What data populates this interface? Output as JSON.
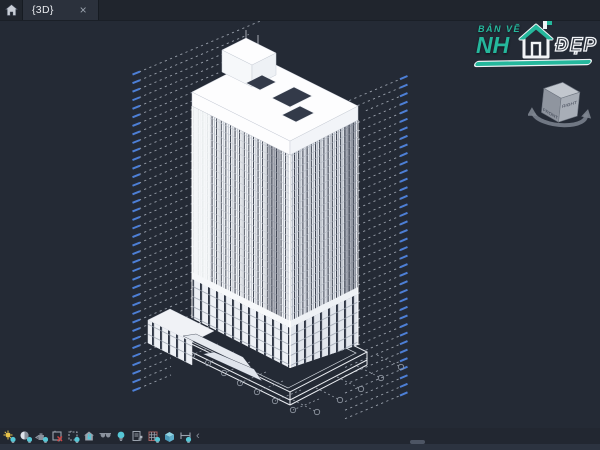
{
  "window": {
    "tab_label": "{3D}",
    "close_label": "×"
  },
  "watermark": {
    "line1": "BẢN VẼ",
    "line2": "NH",
    "line3": "ĐẸP"
  },
  "viewcube": {
    "front_label": "FRONT",
    "right_label": "RIGHT"
  },
  "toolbar": {
    "collapse_label": "‹",
    "icons": [
      {
        "name": "sun-path-icon"
      },
      {
        "name": "shadows-icon"
      },
      {
        "name": "rendering-dialog-icon"
      },
      {
        "name": "crop-view-off-icon"
      },
      {
        "name": "crop-region-icon"
      },
      {
        "name": "locked-orientation-icon"
      },
      {
        "name": "temporary-hide-isolate-icon"
      },
      {
        "name": "reveal-hidden-elements-icon"
      },
      {
        "name": "temporary-view-properties-icon"
      },
      {
        "name": "analytical-model-icon"
      },
      {
        "name": "displacement-sets-icon"
      },
      {
        "name": "reveal-constraints-icon"
      }
    ]
  },
  "colors": {
    "background": "#242a35",
    "accent_teal": "#56c7d6",
    "level_tick_blue": "#4d7fd6",
    "level_dash_gray": "#a6adb8",
    "logo_teal": "#25b79c",
    "building_white": "#f3f5f8"
  }
}
